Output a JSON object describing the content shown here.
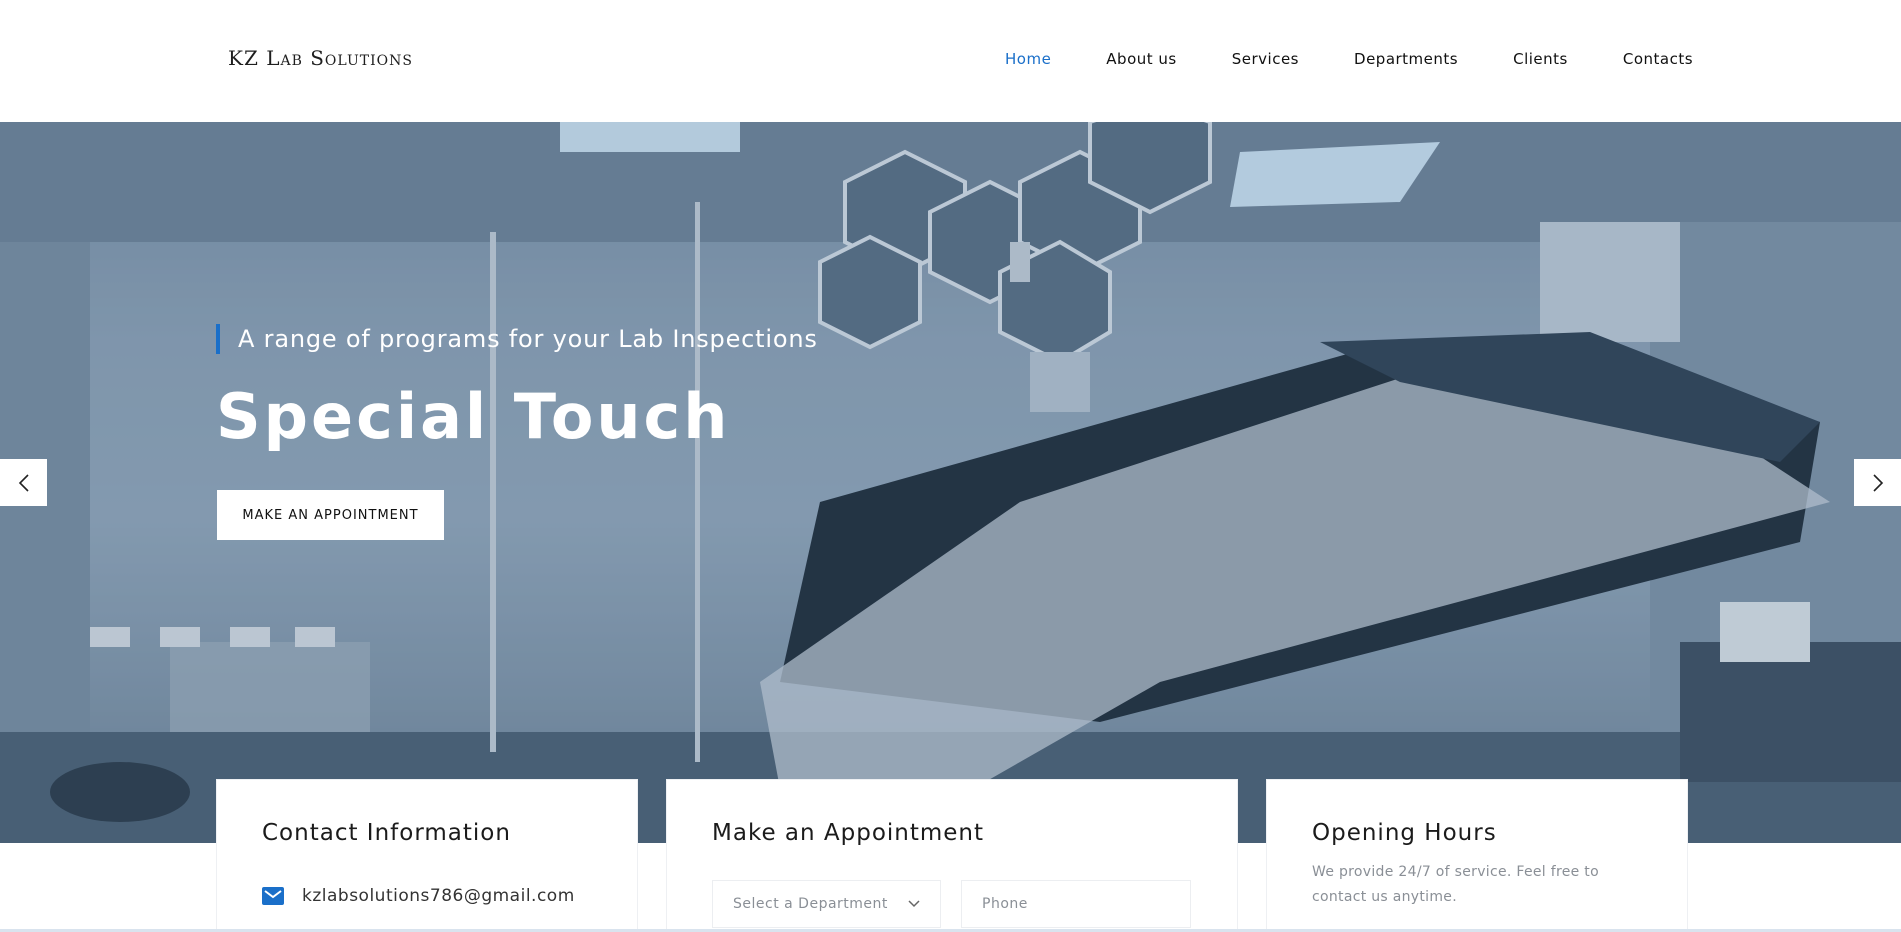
{
  "header": {
    "logo": "KZ Lab Solutions",
    "nav": [
      "Home",
      "About us",
      "Services",
      "Departments",
      "Clients",
      "Contacts"
    ],
    "active_nav": "Home"
  },
  "hero": {
    "subtitle": "A range of programs for your Lab Inspections",
    "title": "Special Touch",
    "cta_label": "MAKE AN APPOINTMENT"
  },
  "cards": {
    "contact": {
      "title": "Contact Information",
      "email": "kzlabsolutions786@gmail.com"
    },
    "appointment": {
      "title": "Make an Appointment",
      "department_placeholder": "Select a Department",
      "phone_placeholder": "Phone"
    },
    "hours": {
      "title": "Opening Hours",
      "text": "We provide 24/7 of service. Feel free to contact us anytime."
    }
  },
  "colors": {
    "accent": "#1a6fc9",
    "hero_tint": "#5e7690"
  },
  "icons": [
    "email-icon",
    "chevron-down-icon",
    "chevron-left-icon",
    "chevron-right-icon"
  ]
}
